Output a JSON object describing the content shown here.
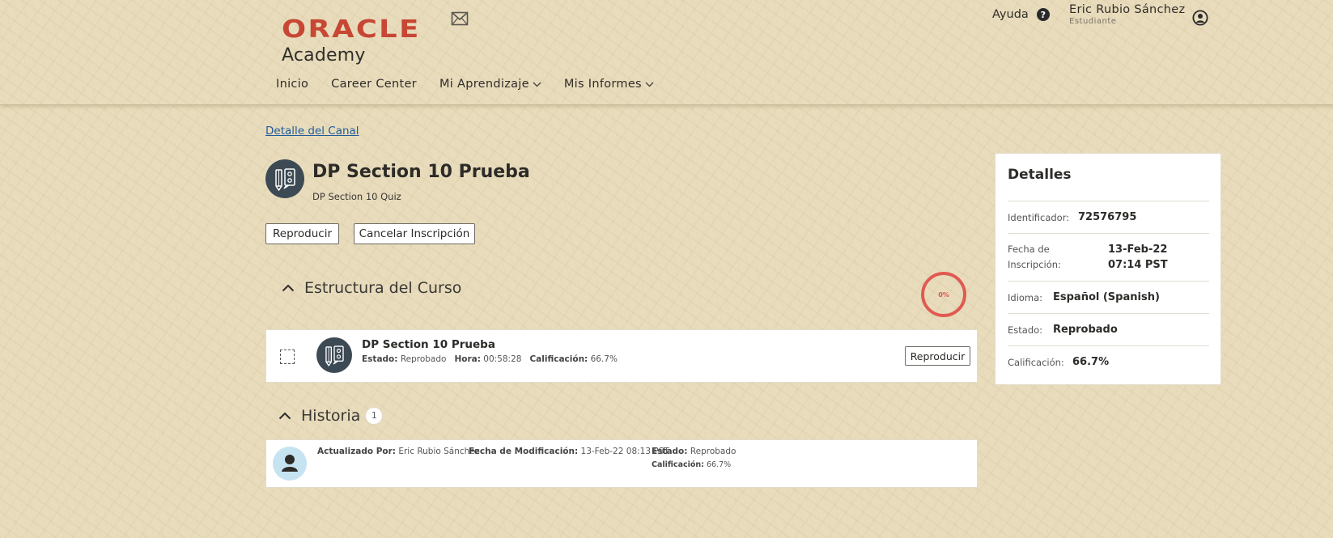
{
  "header": {
    "logo_oracle": "ORACLE",
    "logo_academy": "Academy",
    "nav": [
      {
        "label": "Inicio"
      },
      {
        "label": "Career Center"
      },
      {
        "label": "Mi Aprendizaje"
      },
      {
        "label": "Mis Informes"
      }
    ],
    "help_label": "Ayuda",
    "user_name": "Eric Rubio Sánchez",
    "user_role": "Estudiante"
  },
  "breadcrumb": "Detalle del Canal",
  "course": {
    "title": "DP Section 10 Prueba",
    "subtitle": "DP Section 10 Quiz",
    "play_button": "Reproducir",
    "cancel_button": "Cancelar Inscripción"
  },
  "structure": {
    "heading": "Estructura del Curso",
    "progress_label": "0%",
    "item": {
      "title": "DP Section 10 Prueba",
      "status_label": "Estado:",
      "status_value": "Reprobado",
      "time_label": "Hora:",
      "time_value": "00:58:28",
      "grade_label": "Calificación:",
      "grade_value": "66.7%",
      "play_button": "Reproducir"
    }
  },
  "history": {
    "heading": "Historia",
    "count": "1",
    "entry": {
      "updated_label": "Actualizado Por:",
      "updated_value": "Eric Rubio Sánchez",
      "modified_label": "Fecha de Modificación:",
      "modified_value": "13-Feb-22 08:13 PST",
      "status_label": "Estado:",
      "status_value": "Reprobado",
      "grade_label": "Calificación:",
      "grade_value": "66.7%"
    }
  },
  "details": {
    "title": "Detalles",
    "rows": [
      {
        "label": "Identificador:",
        "value": "72576795"
      },
      {
        "label": "Fecha de Inscripción:",
        "value": "13-Feb-22 07:14 PST"
      },
      {
        "label": "Idioma:",
        "value": "Español (Spanish)"
      },
      {
        "label": "Estado:",
        "value": "Reprobado"
      },
      {
        "label": "Calificación:",
        "value": "66.7%"
      }
    ]
  },
  "colors": {
    "brand_red": "#c74634",
    "link_blue": "#1f5b9b",
    "progress_red": "#e05a52",
    "background": "#e8dcbc"
  }
}
